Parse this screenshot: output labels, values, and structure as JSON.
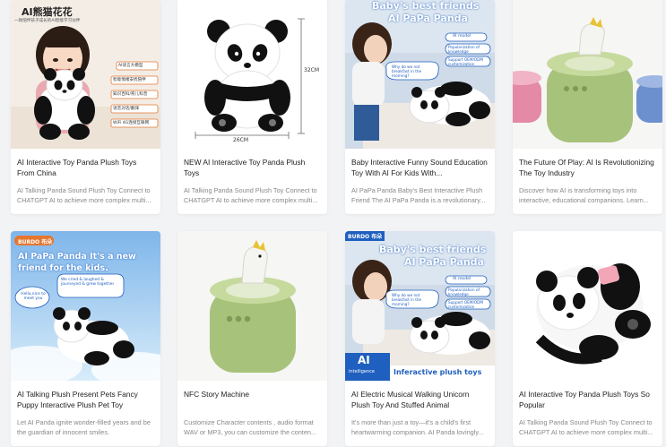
{
  "products": [
    {
      "title": "AI Interactive Toy Panda Plush Toys From China",
      "desc": "AI Talking Panda Sound Plush Toy Connect to CHATGPT AI to achieve more complex multi...",
      "image": {
        "heading": "AI熊猫花花",
        "subheading": "一款陪伴孩子成长的AI智能学习伙伴",
        "tags": [
          "AI语言大模型",
          "智能情绪安抚陪伴",
          "知识百科/育儿科普",
          "语音对话/翻译",
          "WiFi 4G连接互联网"
        ]
      }
    },
    {
      "title": "NEW AI Interactive Toy Panda Plush Toys",
      "desc": "AI Talking Panda Sound Plush Toy Connect to CHATGPT AI to achieve more complex multi...",
      "image": {
        "height_label": "32CM",
        "width_label": "26CM"
      }
    },
    {
      "title": "Baby Interactive Funny Sound Education Toy With AI For Kids With...",
      "desc": "AI PaPa Panda Baby's Best Interactive Plush Friend The AI PaPa Panda is a revolutionary...",
      "image": {
        "headline1": "Baby's best friends",
        "headline2": "AI PaPa Panda",
        "badges": [
          "AI model",
          "Popularization of knowledge",
          "Support OEM/ODM customization"
        ],
        "bubble": "Why do we not breakfast in the morning?"
      }
    },
    {
      "title": "The Future Of Play: AI Is Revolutionizing The Toy Industry",
      "desc": "Discover how AI is transforming toys into interactive, educational companions. Learn...",
      "image": {}
    },
    {
      "title": "AI Talking Plush Present Pets Fancy Puppy Interactive Plush Pet Toy",
      "desc": "Let AI Panda ignite wonder-filled years and be the guardian of innocent smiles.",
      "image": {
        "brand": "BURDO 布朵",
        "headline": "AI PaPa Panda It's a new friend for the kids.",
        "bubble1": "We cried & laughed & journeyed & grew together",
        "bubble2": "Hello,nice to meet you"
      }
    },
    {
      "title": "NFC Story Machine",
      "desc": "Customize Character contents , audio format WAV or MP3, you can customize the conten...",
      "image": {}
    },
    {
      "title": "AI Electric Musical Walking Unicorn Plush Toy And Stuffed Animal",
      "desc": "It's more than just a toy—it's a child's first heartwarming companion. AI Panda lovingly...",
      "image": {
        "brand": "BURDO 布朵",
        "headline1": "Baby's best friends",
        "headline2": "AI PaPa Panda",
        "badges": [
          "AI model",
          "Popularization of knowledge",
          "Support OEM/ODM customization"
        ],
        "bubble": "Why do we not breakfast in the morning?",
        "ai_badge_1": "AI",
        "ai_badge_2": "intelligence",
        "footer": "Inferactive plush toys"
      }
    },
    {
      "title": "AI Interactive Toy Panda Plush Toys So Popular",
      "desc": "AI Talking Panda Sound Plush Toy Connect to CHATGPT AI to achieve more complex multi...",
      "image": {}
    }
  ],
  "colors": {
    "title": "#222222",
    "desc": "#888888",
    "card_bg": "#ffffff",
    "page_bg": "#f2f3f5",
    "accent_blue": "#1f5fbf"
  }
}
